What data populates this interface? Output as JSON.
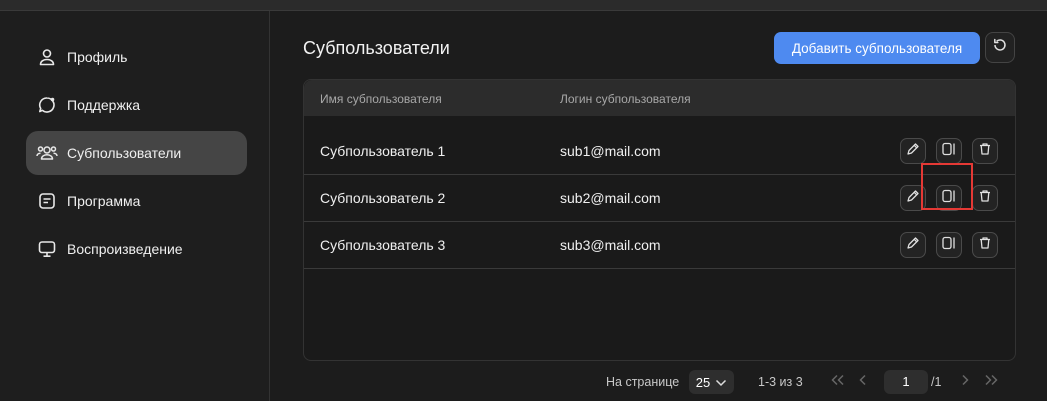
{
  "sidebar": {
    "items": [
      {
        "label": "Профиль",
        "icon": "user-icon",
        "active": false
      },
      {
        "label": "Поддержка",
        "icon": "chat-bubble-icon",
        "active": false
      },
      {
        "label": "Субпользователи",
        "icon": "users-group-icon",
        "active": true
      },
      {
        "label": "Программа",
        "icon": "program-list-icon",
        "active": false
      },
      {
        "label": "Воспроизведение",
        "icon": "monitor-icon",
        "active": false
      }
    ]
  },
  "main": {
    "title": "Субпользователи",
    "add_button_label": "Добавить субпользователя",
    "refresh_icon": "refresh-icon",
    "table": {
      "columns": [
        "Имя субпользователя",
        "Логин субпользователя"
      ],
      "rows": [
        {
          "name": "Субпользователь 1",
          "login": "sub1@mail.com"
        },
        {
          "name": "Субпользователь 2",
          "login": "sub2@mail.com"
        },
        {
          "name": "Субпользователь 3",
          "login": "sub3@mail.com"
        }
      ],
      "row_actions": [
        "pencil-icon",
        "panel-toggle-icon",
        "trash-icon"
      ]
    },
    "pagination": {
      "per_page_label": "На странице",
      "per_page_value": "25",
      "range_text": "1-3 из 3",
      "current_page": "1",
      "total_pages": "/1"
    }
  },
  "colors": {
    "accent": "#4e8af0",
    "highlight": "#e53935",
    "background": "#1c1c1c",
    "active_nav": "#454545"
  }
}
